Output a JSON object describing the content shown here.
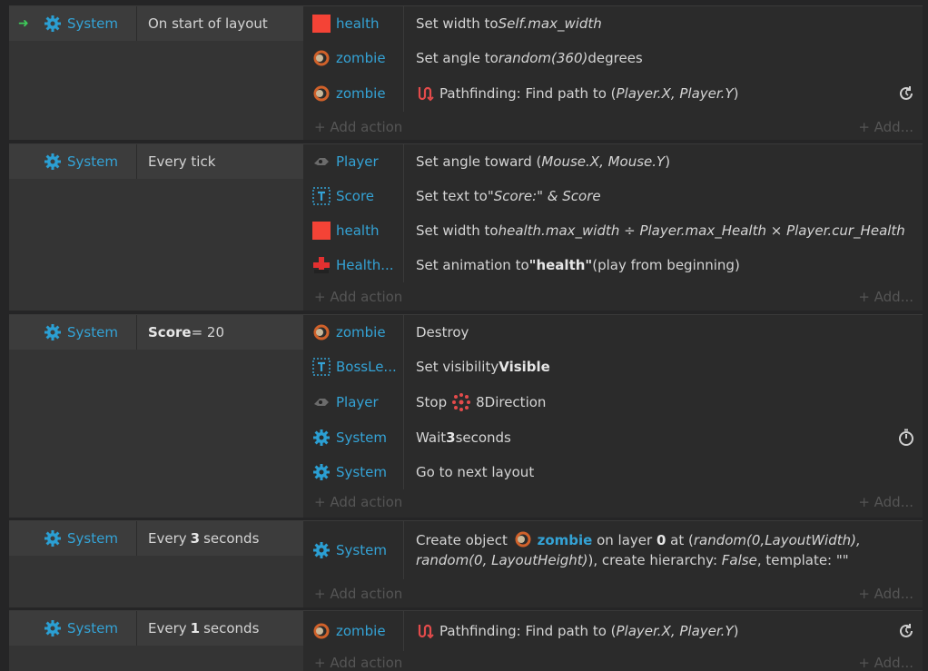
{
  "add_action_label": "+ Add action",
  "add_more_label": "+ Add...",
  "colors": {
    "object_name": "#34a3d6",
    "accent_arrow": "#3ecb5a",
    "health_red": "#f44336"
  },
  "events": [
    {
      "condition_object": "System",
      "condition_text": "On start of layout",
      "actions": [
        {
          "icon": "health-sprite-icon",
          "object": "health",
          "parts": [
            [
              "Set width to ",
              ""
            ],
            [
              "Self.max_width",
              "i"
            ]
          ]
        },
        {
          "icon": "zombie-sprite-icon",
          "object": "zombie",
          "parts": [
            [
              "Set angle to ",
              ""
            ],
            [
              "random(360)",
              "i"
            ],
            [
              " degrees",
              ""
            ]
          ]
        },
        {
          "icon": "zombie-sprite-icon",
          "object": "zombie",
          "inner_icon": "pathfinding-icon",
          "parts": [
            [
              "Pathfinding: Find path to (",
              ""
            ],
            [
              "Player.X, Player.Y",
              "i"
            ],
            [
              ")",
              ""
            ]
          ],
          "badge": "async-refresh-icon"
        }
      ]
    },
    {
      "condition_object": "System",
      "condition_text": "Every tick",
      "actions": [
        {
          "icon": "player-sprite-icon",
          "object": "Player",
          "parts": [
            [
              "Set angle toward (",
              ""
            ],
            [
              "Mouse.X, Mouse.Y",
              "i"
            ],
            [
              ")",
              ""
            ]
          ]
        },
        {
          "icon": "text-object-icon",
          "object": "Score",
          "parts": [
            [
              "Set text to ",
              ""
            ],
            [
              "\"Score:\" & Score",
              "i"
            ]
          ]
        },
        {
          "icon": "health-sprite-icon",
          "object": "health",
          "parts": [
            [
              "Set width to ",
              ""
            ],
            [
              "health.max_width ÷ Player.max_Health × Player.cur_Health",
              "i"
            ]
          ]
        },
        {
          "icon": "health-bar-sprite-icon",
          "object": "Health...",
          "parts": [
            [
              "Set animation to ",
              ""
            ],
            [
              "\"health\"",
              "b"
            ],
            [
              " (play from beginning)",
              ""
            ]
          ]
        }
      ]
    },
    {
      "condition_object": "System",
      "condition_parts": [
        [
          "Score",
          "b"
        ],
        [
          " = 20",
          ""
        ]
      ],
      "actions": [
        {
          "icon": "zombie-sprite-icon",
          "object": "zombie",
          "parts": [
            [
              "Destroy",
              ""
            ]
          ]
        },
        {
          "icon": "text-object-icon",
          "object": "BossLe...",
          "parts": [
            [
              "Set visibility ",
              ""
            ],
            [
              "Visible",
              "b"
            ]
          ]
        },
        {
          "icon": "player-sprite-icon",
          "object": "Player",
          "inner_icon_after": "8direction-icon",
          "parts": [
            [
              "Stop ",
              ""
            ]
          ],
          "parts_after": [
            [
              "8Direction",
              ""
            ]
          ]
        },
        {
          "icon": "system-gear-icon",
          "object": "System",
          "parts": [
            [
              "Wait ",
              ""
            ],
            [
              "3",
              "b"
            ],
            [
              " seconds",
              ""
            ]
          ],
          "badge": "timer-icon"
        },
        {
          "icon": "system-gear-icon",
          "object": "System",
          "parts": [
            [
              "Go to next layout",
              ""
            ]
          ]
        }
      ]
    },
    {
      "condition_object": "System",
      "condition_parts": [
        [
          "Every ",
          ""
        ],
        [
          "3",
          "b"
        ],
        [
          " seconds",
          ""
        ]
      ],
      "actions": [
        {
          "icon": "system-gear-icon",
          "object": "System",
          "multi": true,
          "parts": [
            [
              "Create object ",
              ""
            ],
            [
              "§zombie",
              "icon"
            ],
            [
              "zombie",
              "bb"
            ],
            [
              " on layer ",
              ""
            ],
            [
              "0",
              "b"
            ],
            [
              " at (",
              ""
            ],
            [
              "random(0,LayoutWidth), random(0, LayoutHeight)",
              "i"
            ],
            [
              "), create hierarchy: ",
              ""
            ],
            [
              "False",
              "i"
            ],
            [
              ", template: \"\"",
              ""
            ]
          ]
        }
      ]
    },
    {
      "condition_object": "System",
      "condition_parts": [
        [
          "Every ",
          ""
        ],
        [
          "1",
          "b"
        ],
        [
          " seconds",
          ""
        ]
      ],
      "actions": [
        {
          "icon": "zombie-sprite-icon",
          "object": "zombie",
          "inner_icon": "pathfinding-icon",
          "parts": [
            [
              "Pathfinding: Find path to (",
              ""
            ],
            [
              "Player.X, Player.Y",
              "i"
            ],
            [
              ")",
              ""
            ]
          ],
          "badge": "async-refresh-icon"
        }
      ]
    }
  ]
}
